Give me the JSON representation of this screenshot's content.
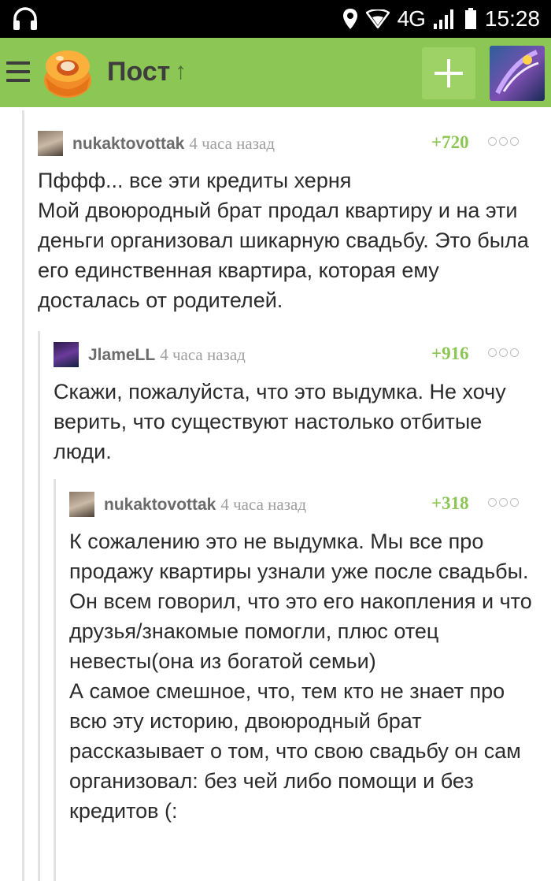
{
  "status_bar": {
    "time": "15:28",
    "network": "4G",
    "icons": [
      "headphones-icon",
      "location-icon",
      "wifi-icon",
      "signal-icon",
      "battery-icon"
    ]
  },
  "toolbar": {
    "title": "Пост",
    "add_icon": "plus-icon",
    "menu_icon": "hamburger-icon",
    "colors": {
      "background": "#8cc654",
      "rating": "#8cc654"
    }
  },
  "comments": [
    {
      "author": "nukaktovottak",
      "time": "4 часа назад",
      "rating": "+720",
      "text": "Пффф... все эти кредиты херня\nМой двоюродный брат продал квартиру и на эти деньги организовал шикарную свадьбу. Это была его единственная квартира, которая ему досталась от родителей."
    },
    {
      "author": "JlameLL",
      "time": "4 часа назад",
      "rating": "+916",
      "text": "Скажи, пожалуйста, что это выдумка. Не хочу верить, что существуют настолько отбитые люди."
    },
    {
      "author": "nukaktovottak",
      "time": "4 часа назад",
      "rating": "+318",
      "text": "К сожалению это не выдумка. Мы все про продажу квартиры узнали уже после свадьбы.\nОн всем говорил, что это его накопления и что друзья/знакомые помогли, плюс отец невесты(она из богатой семьи)\nА самое смешное, что, тем кто не знает про всю эту историю, двоюродный брат рассказывает о том, что свою свадьбу он сам организовал: без чей либо помощи и без кредитов (:"
    }
  ]
}
